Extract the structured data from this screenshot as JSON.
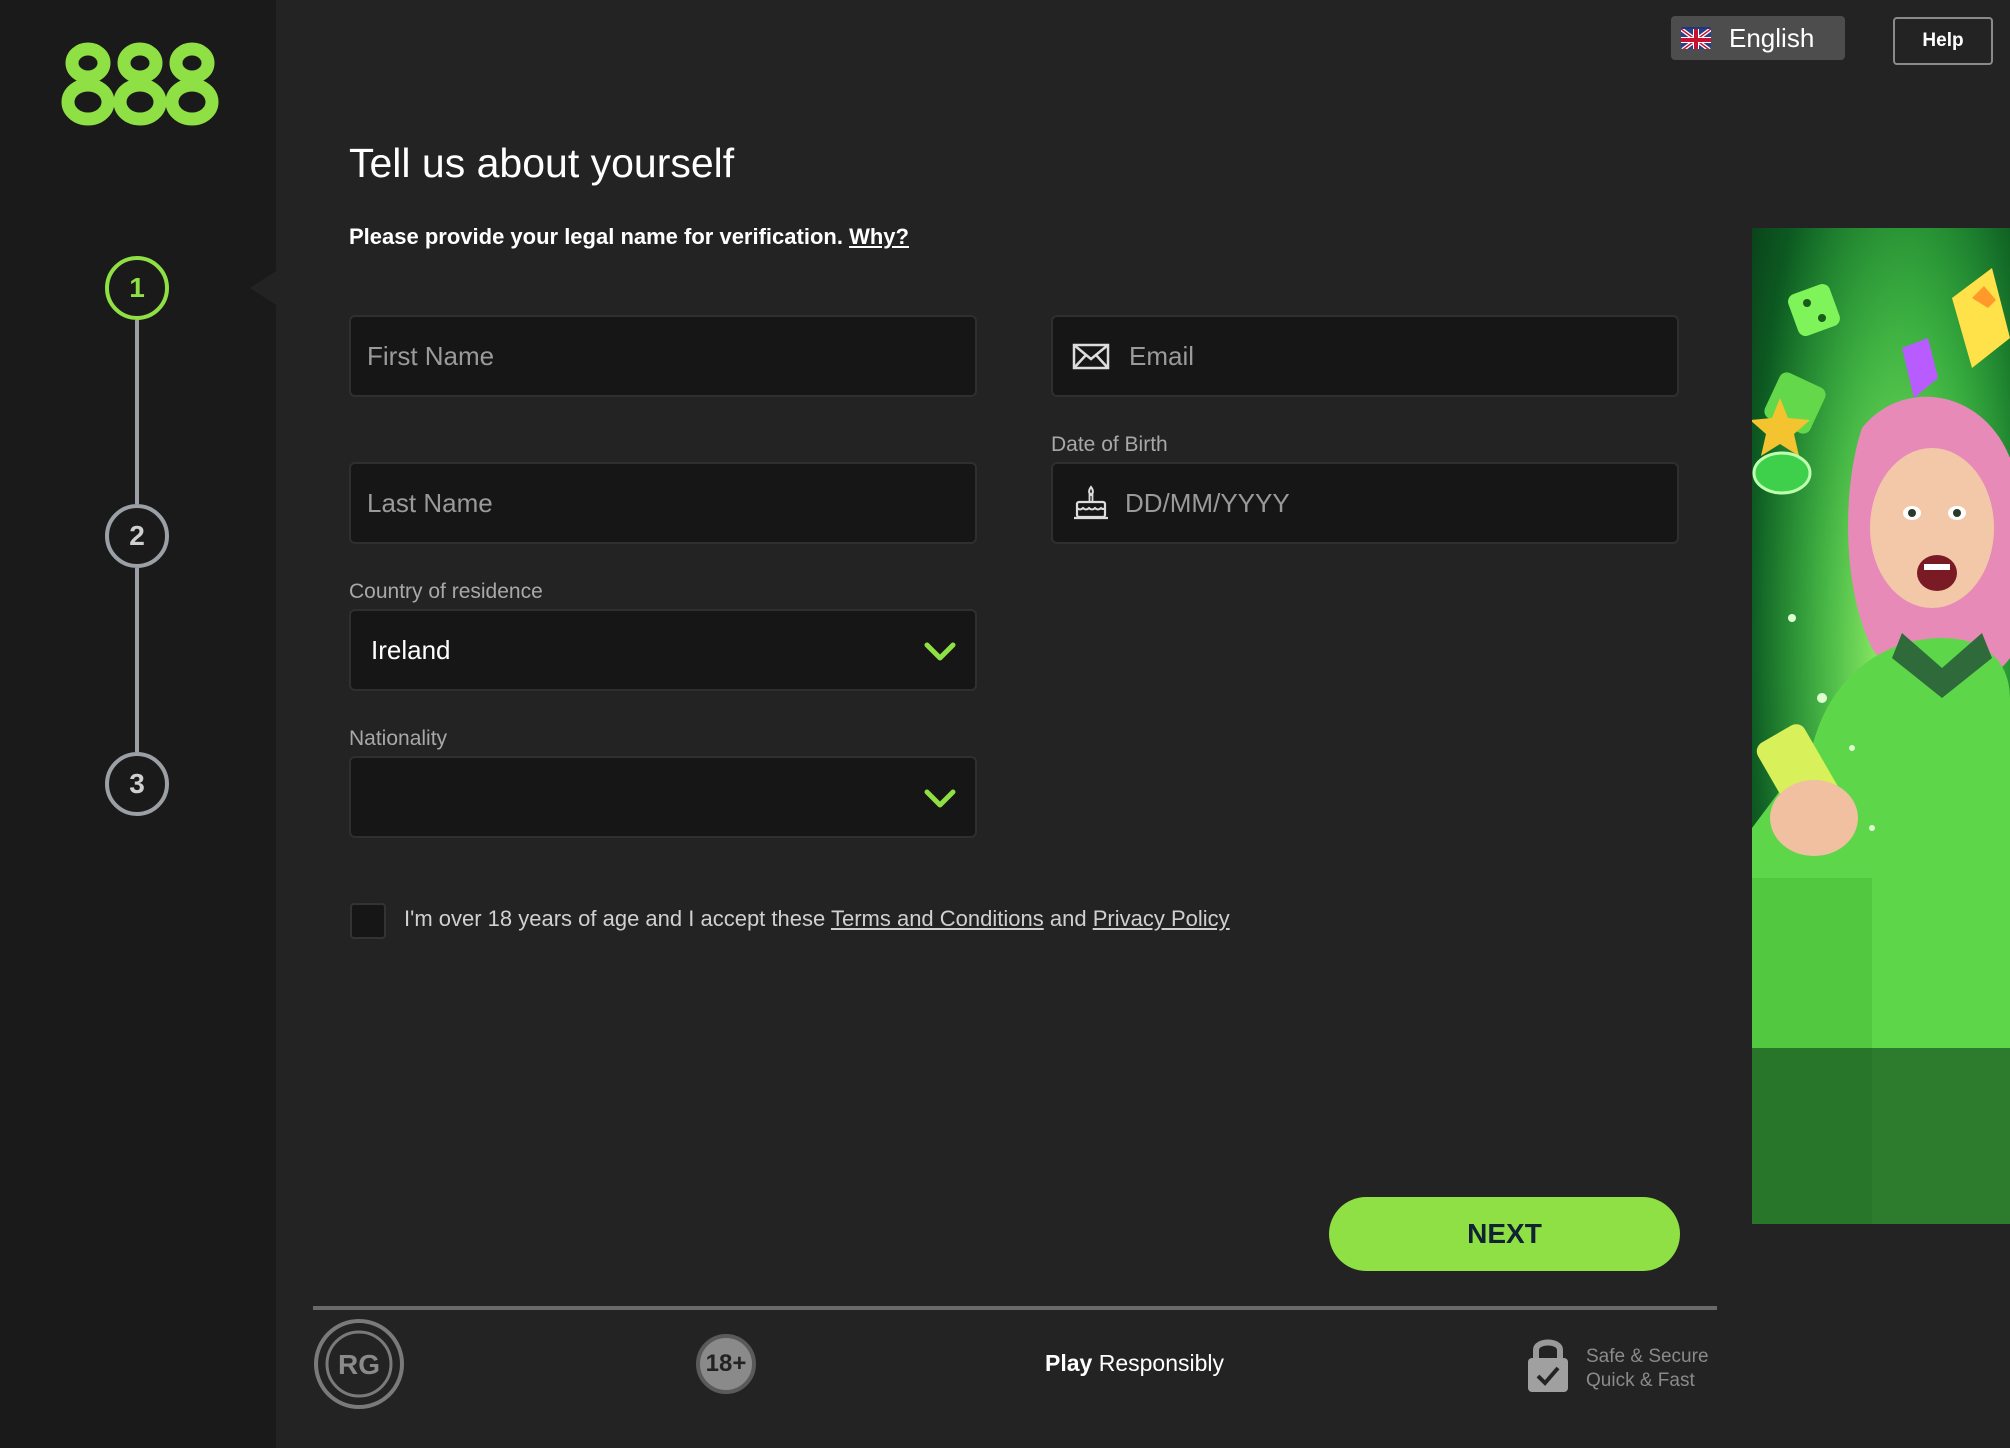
{
  "brand": {
    "logo_text": "888",
    "accent": "#8ee045"
  },
  "steps": [
    "1",
    "2",
    "3"
  ],
  "header": {
    "language_label": "English",
    "flag_code": "en",
    "help_label": "Help"
  },
  "form": {
    "title": "Tell us about yourself",
    "subtitle": "Please provide your legal name for verification.",
    "why_link": "Why?",
    "first_name_placeholder": "First Name",
    "last_name_placeholder": "Last Name",
    "email_placeholder": "Email",
    "dob_label": "Date of Birth",
    "dob_placeholder": "DD/MM/YYYY",
    "country_label": "Country of residence",
    "country_value": "Ireland",
    "nationality_label": "Nationality",
    "nationality_value": "",
    "terms_prefix": "I'm over 18 years of age and I accept these",
    "terms_link": "Terms and Conditions",
    "terms_and": "and",
    "privacy_link": "Privacy Policy",
    "next_label": "NEXT"
  },
  "footer": {
    "rg_label": "RG",
    "age_label": "18+",
    "play_bold": "Play",
    "play_rest": "Responsibly",
    "secure_line1": "Safe & Secure",
    "secure_line2": "Quick & Fast"
  }
}
